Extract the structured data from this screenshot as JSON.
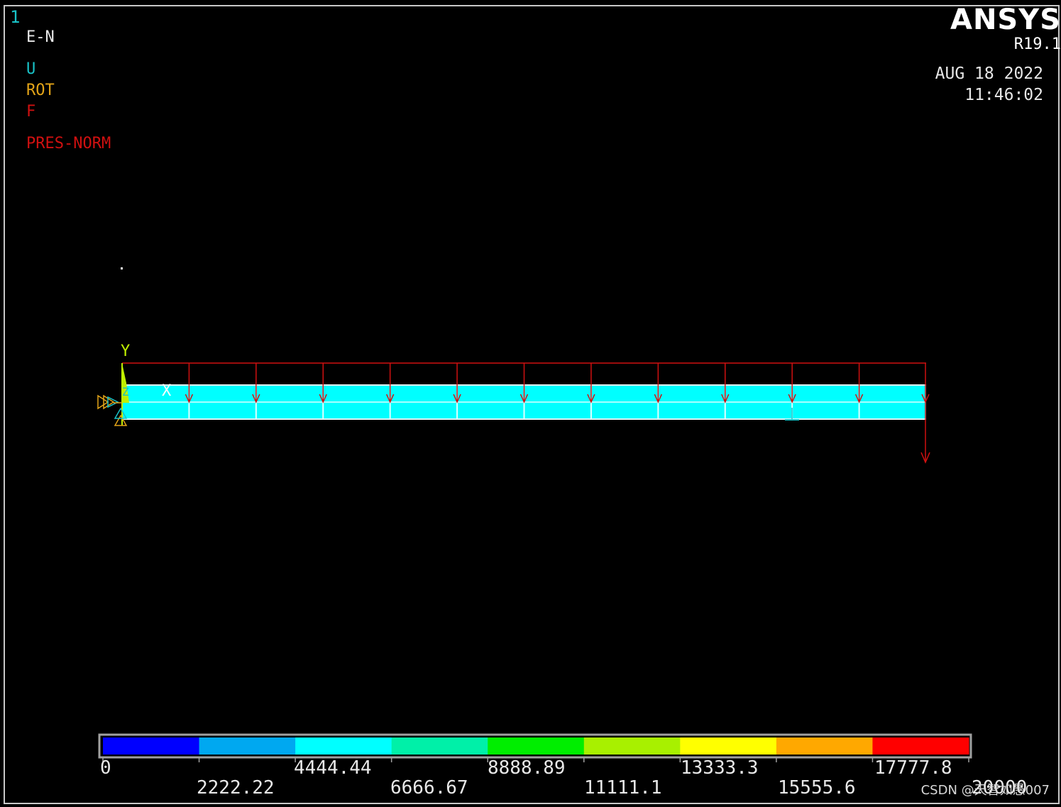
{
  "window_number": "1",
  "legend": {
    "display_mode": "E-N",
    "symbols": [
      {
        "text": "U",
        "color": "#19c3c8"
      },
      {
        "text": "ROT",
        "color": "#e3a418"
      },
      {
        "text": "F",
        "color": "#d01010"
      }
    ],
    "pressure_label": "PRES-NORM"
  },
  "branding": {
    "product": "ANSYS",
    "version": "R19.1",
    "date": "AUG 18 2022",
    "time": "11:46:02"
  },
  "axes": {
    "y": "Y",
    "x": "X",
    "z": "Z"
  },
  "colorbar": {
    "colors": [
      "#0000ff",
      "#00a8f0",
      "#00ffff",
      "#00f0a8",
      "#00ee00",
      "#a8f000",
      "#ffff00",
      "#ffa800",
      "#ff0000"
    ],
    "labels_top": [
      "0",
      "4444.44",
      "8888.89",
      "13333.3",
      "17777.8"
    ],
    "labels_bottom": [
      "2222.22",
      "6666.67",
      "11111.1",
      "15555.6",
      "20000"
    ]
  },
  "watermark": "CSDN @天智如愚007"
}
